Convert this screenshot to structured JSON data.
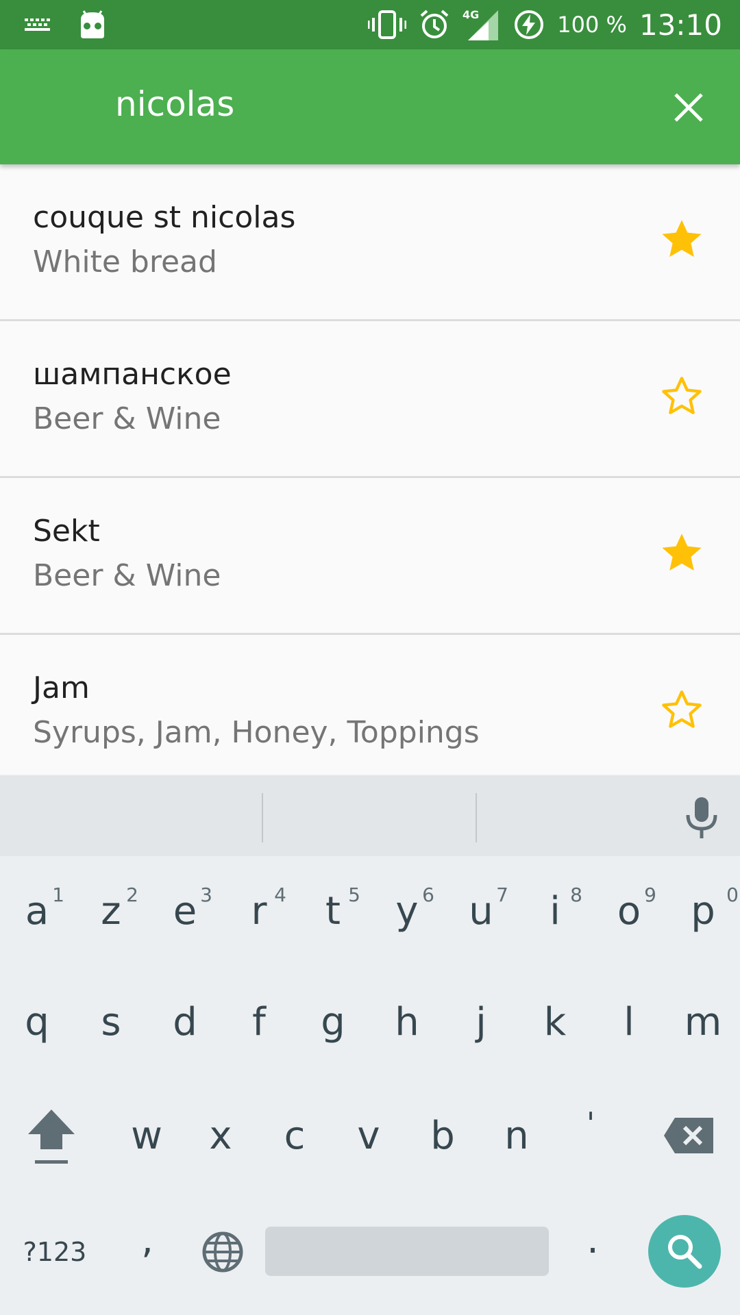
{
  "status_bar": {
    "battery": "100 %",
    "time": "13:10",
    "network": "4G",
    "icons": [
      "keyboard-icon",
      "android-debug-icon",
      "vibrate-icon",
      "alarm-icon",
      "signal-4g-icon",
      "battery-charging-icon"
    ]
  },
  "search": {
    "query": "nicolas",
    "close_icon": "close-icon"
  },
  "results": [
    {
      "name": "couque st nicolas",
      "category": "White bread",
      "favorite": true
    },
    {
      "name": "шампанское",
      "category": "Beer & Wine",
      "favorite": false
    },
    {
      "name": "Sekt",
      "category": "Beer & Wine",
      "favorite": true
    },
    {
      "name": "Jam",
      "category": "Syrups, Jam, Honey, Toppings",
      "favorite": false
    }
  ],
  "keyboard": {
    "row1": [
      {
        "letter": "a",
        "hint": "1"
      },
      {
        "letter": "z",
        "hint": "2"
      },
      {
        "letter": "e",
        "hint": "3"
      },
      {
        "letter": "r",
        "hint": "4"
      },
      {
        "letter": "t",
        "hint": "5"
      },
      {
        "letter": "y",
        "hint": "6"
      },
      {
        "letter": "u",
        "hint": "7"
      },
      {
        "letter": "i",
        "hint": "8"
      },
      {
        "letter": "o",
        "hint": "9"
      },
      {
        "letter": "p",
        "hint": "0"
      }
    ],
    "row2": [
      "q",
      "s",
      "d",
      "f",
      "g",
      "h",
      "j",
      "k",
      "l",
      "m"
    ],
    "row3": [
      "w",
      "x",
      "c",
      "v",
      "b",
      "n",
      "'"
    ],
    "symbols_label": "?123",
    "comma": ",",
    "period": ".",
    "colors": {
      "accent": "#4db6ac",
      "star": "#ffc107",
      "toolbar": "#4caf50",
      "statusbar": "#388e3c"
    }
  }
}
